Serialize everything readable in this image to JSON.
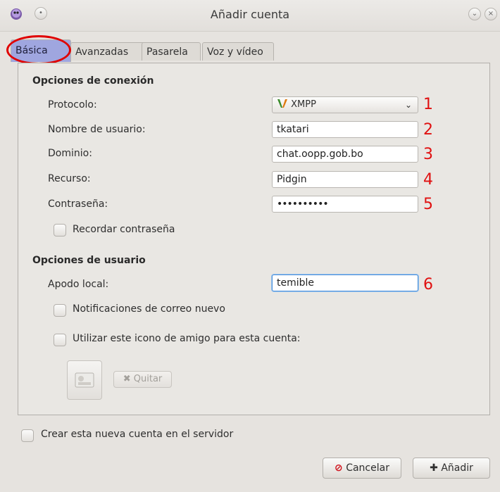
{
  "window": {
    "title": "Añadir cuenta",
    "icon": "pidgin-icon"
  },
  "tabs": [
    {
      "label": "Básica",
      "active": true
    },
    {
      "label": "Avanzadas",
      "active": false
    },
    {
      "label": "Pasarela",
      "active": false
    },
    {
      "label": "Voz y vídeo",
      "active": false
    }
  ],
  "connection": {
    "heading": "Opciones de conexión",
    "protocol_label": "Protocolo:",
    "protocol_value": "XMPP",
    "username_label": "Nombre de usuario:",
    "username_value": "tkatari",
    "domain_label": "Dominio:",
    "domain_value": "chat.oopp.gob.bo",
    "resource_label": "Recurso:",
    "resource_value": "Pidgin",
    "password_label": "Contraseña:",
    "password_value": "••••••••••",
    "remember_label": "Recordar contraseña",
    "remember_checked": false
  },
  "user": {
    "heading": "Opciones de usuario",
    "alias_label": "Apodo local:",
    "alias_value": "temible",
    "mail_label": "Notificaciones de correo nuevo",
    "mail_checked": false,
    "buddy_icon_label": "Utilizar este icono de amigo para esta cuenta:",
    "buddy_icon_checked": false,
    "remove_label": "Quitar"
  },
  "annotations": [
    "1",
    "2",
    "3",
    "4",
    "5",
    "6"
  ],
  "create_on_server_label": "Crear esta nueva cuenta en el servidor",
  "create_on_server_checked": false,
  "buttons": {
    "cancel": "Cancelar",
    "add": "Añadir"
  },
  "colors": {
    "annotation": "#e01010",
    "active_tab": "#9fa6df",
    "focus": "#4a90d9"
  }
}
